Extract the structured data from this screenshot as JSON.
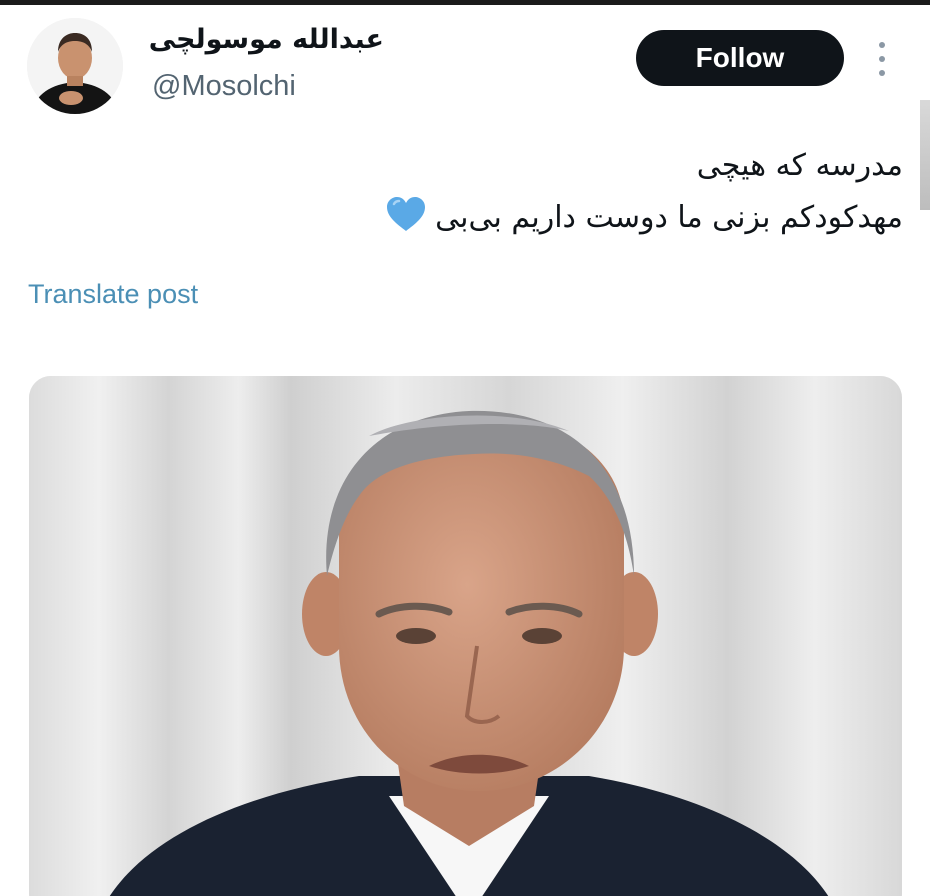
{
  "author": {
    "display_name": "عبدالله موسولچی",
    "handle": "@Mosolchi"
  },
  "actions": {
    "follow_label": "Follow"
  },
  "tweet": {
    "lines": [
      "مدرسه که هیچی",
      "مهدکودکم بزنی ما دوست داریم بی‌بی"
    ],
    "emoji": "blue-heart-icon"
  },
  "translate": {
    "label": "Translate post"
  },
  "media": {
    "description_icon": "photo-of-man-in-suit"
  },
  "colors": {
    "follow_bg": "#0f1419",
    "translate_link": "#4b8fb5",
    "handle": "#536471",
    "heart": "#5aa9e6"
  }
}
